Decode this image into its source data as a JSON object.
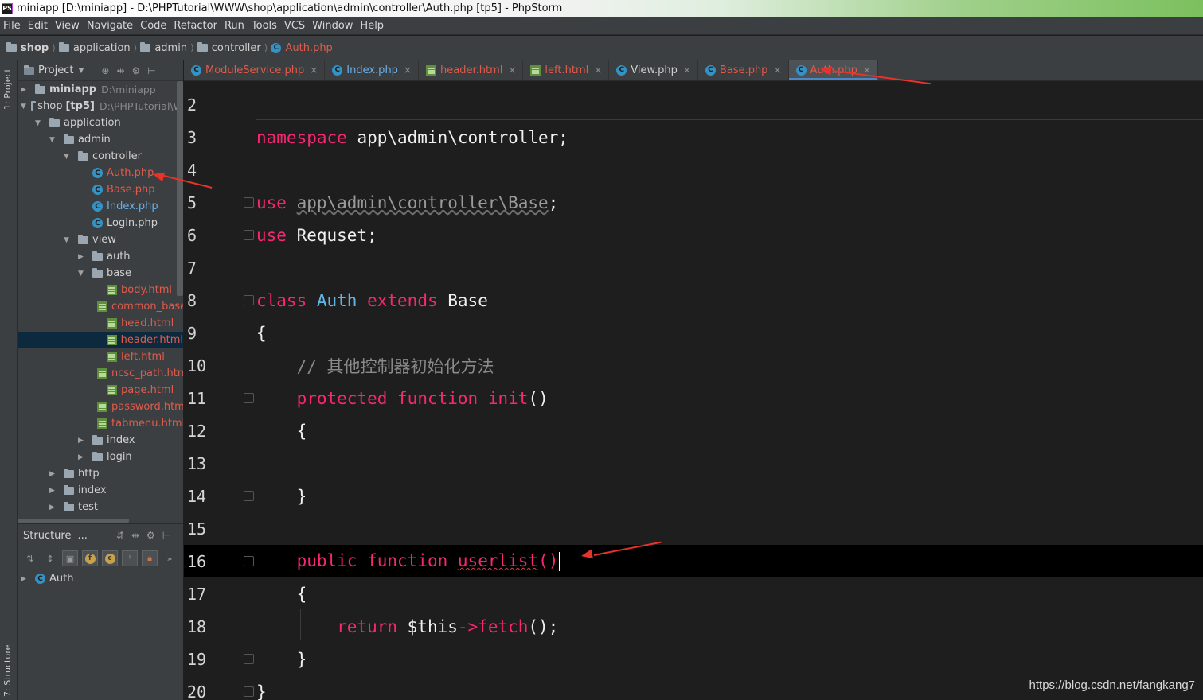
{
  "window": {
    "title": "miniapp [D:\\miniapp] - D:\\PHPTutorial\\WWW\\shop\\application\\admin\\controller\\Auth.php [tp5] - PhpStorm",
    "app_badge": "PS"
  },
  "menu": [
    "File",
    "Edit",
    "View",
    "Navigate",
    "Code",
    "Refactor",
    "Run",
    "Tools",
    "VCS",
    "Window",
    "Help"
  ],
  "breadcrumb": [
    "shop",
    "application",
    "admin",
    "controller",
    "Auth.php"
  ],
  "side_tabs": {
    "project": "1: Project",
    "structure": "7: Structure"
  },
  "project_panel": {
    "title": "Project",
    "tree": [
      {
        "label": "miniapp",
        "path": "D:\\miniapp",
        "type": "folder",
        "expanded": false,
        "depth": 0,
        "bold": true
      },
      {
        "label": "shop",
        "tag": "[tp5]",
        "path": "D:\\PHPTutorial\\W",
        "type": "folder",
        "expanded": true,
        "depth": 0
      },
      {
        "label": "application",
        "type": "folder",
        "expanded": true,
        "depth": 1
      },
      {
        "label": "admin",
        "type": "folder",
        "expanded": true,
        "depth": 2
      },
      {
        "label": "controller",
        "type": "folder",
        "expanded": true,
        "depth": 3
      },
      {
        "label": "Auth.php",
        "type": "class",
        "depth": 4,
        "color": "red"
      },
      {
        "label": "Base.php",
        "type": "class",
        "depth": 4,
        "color": "red"
      },
      {
        "label": "Index.php",
        "type": "class",
        "depth": 4,
        "color": "blue"
      },
      {
        "label": "Login.php",
        "type": "class",
        "depth": 4
      },
      {
        "label": "view",
        "type": "folder",
        "expanded": true,
        "depth": 3
      },
      {
        "label": "auth",
        "type": "folder",
        "expanded": false,
        "depth": 4
      },
      {
        "label": "base",
        "type": "folder",
        "expanded": true,
        "depth": 4
      },
      {
        "label": "body.html",
        "type": "html",
        "depth": 5,
        "color": "red"
      },
      {
        "label": "common_base",
        "type": "html",
        "depth": 5,
        "color": "red"
      },
      {
        "label": "head.html",
        "type": "html",
        "depth": 5,
        "color": "red"
      },
      {
        "label": "header.html",
        "type": "html",
        "depth": 5,
        "color": "red",
        "selected": true
      },
      {
        "label": "left.html",
        "type": "html",
        "depth": 5,
        "color": "red"
      },
      {
        "label": "ncsc_path.htm",
        "type": "html",
        "depth": 5,
        "color": "red"
      },
      {
        "label": "page.html",
        "type": "html",
        "depth": 5,
        "color": "red"
      },
      {
        "label": "password.htm",
        "type": "html",
        "depth": 5,
        "color": "red"
      },
      {
        "label": "tabmenu.html",
        "type": "html",
        "depth": 5,
        "color": "red"
      },
      {
        "label": "index",
        "type": "folder",
        "expanded": false,
        "depth": 4
      },
      {
        "label": "login",
        "type": "folder",
        "expanded": false,
        "depth": 4
      },
      {
        "label": "http",
        "type": "folder",
        "expanded": false,
        "depth": 2
      },
      {
        "label": "index",
        "type": "folder",
        "expanded": false,
        "depth": 2
      },
      {
        "label": "test",
        "type": "folder",
        "expanded": false,
        "depth": 2
      }
    ]
  },
  "structure_panel": {
    "title": "Structure",
    "more": "...",
    "root": "Auth"
  },
  "tabs": [
    {
      "label": "ModuleService.php",
      "icon": "class",
      "color": "red"
    },
    {
      "label": "Index.php",
      "icon": "class",
      "color": "blue"
    },
    {
      "label": "header.html",
      "icon": "html",
      "color": "red"
    },
    {
      "label": "left.html",
      "icon": "html",
      "color": "red"
    },
    {
      "label": "View.php",
      "icon": "class"
    },
    {
      "label": "Base.php",
      "icon": "class",
      "color": "red"
    },
    {
      "label": "Auth.php",
      "icon": "class",
      "color": "red",
      "active": true
    }
  ],
  "editor": {
    "current_line": 16,
    "lines": [
      {
        "n": "2",
        "tokens": []
      },
      {
        "n": "3",
        "tokens": [
          [
            "kw",
            "namespace"
          ],
          [
            "",
            " app\\admin\\controller;"
          ]
        ]
      },
      {
        "n": "4",
        "tokens": []
      },
      {
        "n": "5",
        "tokens": [
          [
            "kw",
            "use"
          ],
          [
            "",
            " "
          ],
          [
            "ns",
            "app\\admin\\controller\\Base"
          ],
          [
            "",
            ";"
          ]
        ]
      },
      {
        "n": "6",
        "tokens": [
          [
            "kw",
            "use"
          ],
          [
            "",
            " Requset;"
          ]
        ]
      },
      {
        "n": "7",
        "tokens": []
      },
      {
        "n": "8",
        "tokens": [
          [
            "kw",
            "class"
          ],
          [
            "",
            " "
          ],
          [
            "cls",
            "Auth"
          ],
          [
            "",
            " "
          ],
          [
            "kw",
            "extends"
          ],
          [
            "",
            " Base"
          ]
        ]
      },
      {
        "n": "9",
        "tokens": [
          [
            "",
            "{"
          ]
        ]
      },
      {
        "n": "10",
        "tokens": [
          [
            "",
            "    "
          ],
          [
            "cm",
            "// 其他控制器初始化方法"
          ]
        ]
      },
      {
        "n": "11",
        "tokens": [
          [
            "",
            "    "
          ],
          [
            "kw",
            "protected"
          ],
          [
            "",
            " "
          ],
          [
            "kw",
            "function"
          ],
          [
            "",
            " "
          ],
          [
            "fn",
            "init"
          ],
          [
            "",
            "()"
          ]
        ]
      },
      {
        "n": "12",
        "tokens": [
          [
            "",
            "    {"
          ]
        ]
      },
      {
        "n": "13",
        "tokens": []
      },
      {
        "n": "14",
        "tokens": [
          [
            "",
            "    }"
          ]
        ]
      },
      {
        "n": "15",
        "tokens": []
      },
      {
        "n": "16",
        "tokens": [
          [
            "",
            "    "
          ],
          [
            "kw",
            "public"
          ],
          [
            "",
            " "
          ],
          [
            "kw",
            "function"
          ],
          [
            "",
            " "
          ],
          [
            "fnsq",
            "userlist"
          ],
          [
            "kw",
            "()"
          ]
        ]
      },
      {
        "n": "17",
        "tokens": [
          [
            "",
            "    {"
          ]
        ]
      },
      {
        "n": "18",
        "tokens": [
          [
            "",
            "        "
          ],
          [
            "kw",
            "return"
          ],
          [
            "",
            " $this"
          ],
          [
            "kw",
            "->"
          ],
          [
            "fn",
            "fetch"
          ],
          [
            "",
            "();"
          ]
        ]
      },
      {
        "n": "19",
        "tokens": [
          [
            "",
            "    }"
          ]
        ]
      },
      {
        "n": "20",
        "tokens": [
          [
            "",
            "}"
          ]
        ]
      }
    ]
  },
  "watermark": "https://blog.csdn.net/fangkang7"
}
